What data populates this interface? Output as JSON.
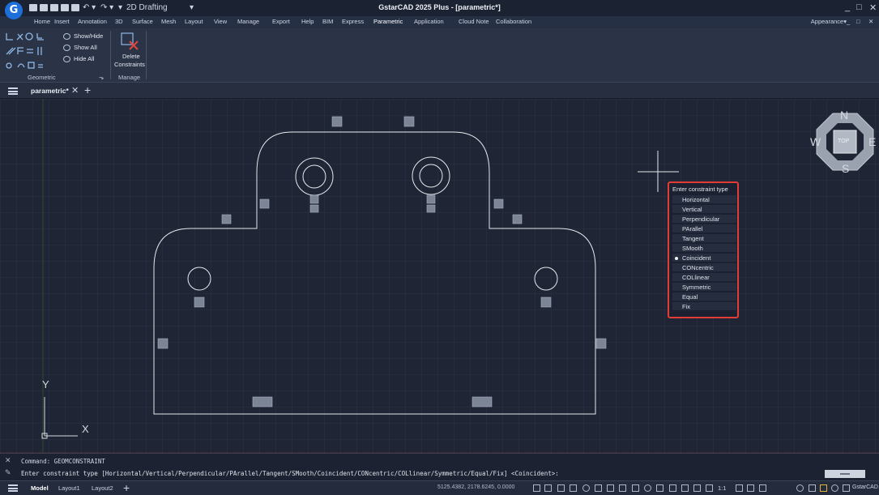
{
  "app": {
    "logo": "G",
    "title": "GstarCAD 2025 Plus - [parametric*]",
    "workspace": "2D Drafting",
    "window_controls": [
      "_",
      "□",
      "✕"
    ]
  },
  "menu": {
    "tabs": [
      "Home",
      "Insert",
      "Annotation",
      "3D",
      "Surface",
      "Mesh",
      "Layout",
      "View",
      "Manage",
      "Export",
      "Help",
      "BIM",
      "Express",
      "Parametric",
      "Application",
      "Cloud Note",
      "Collaboration"
    ],
    "active": "Parametric",
    "appearance": "Appearance"
  },
  "ribbon": {
    "show_hide": "Show/Hide",
    "show_all": "Show All",
    "hide_all": "Hide All",
    "delete_l1": "Delete",
    "delete_l2": "Constraints",
    "group_geometric": "Geometric",
    "group_manage": "Manage"
  },
  "document": {
    "tab": "parametric*"
  },
  "drawing": {
    "ucs_y": "Y",
    "ucs_x": "X",
    "viewcube": {
      "n": "N",
      "s": "S",
      "e": "E",
      "w": "W",
      "top": "TOP"
    }
  },
  "constraint_menu": {
    "title": "Enter constraint type",
    "items": [
      "Horizontal",
      "Vertical",
      "Perpendicular",
      "PArallel",
      "Tangent",
      "SMooth",
      "Coincident",
      "CONcentric",
      "COLlinear",
      "Symmetric",
      "Equal",
      "Fix"
    ],
    "selected": "Coincident"
  },
  "command": {
    "history": "Command: GEOMCONSTRAINT",
    "prompt": "Enter constraint type [Horizontal/Vertical/Perpendicular/PArallel/Tangent/SMooth/Coincident/CONcentric/COLlinear/Symmetric/Equal/Fix] <Coincident>:"
  },
  "status": {
    "tabs": [
      "Model",
      "Layout1",
      "Layout2"
    ],
    "coords": "5125.4382, 2178.6245, 0.0000",
    "scale": "1:1",
    "right_label": "GstarCAD"
  },
  "colors": {
    "background": "#1f2535",
    "ribbon": "#2b3346",
    "popup_border": "#e23d35",
    "geometry": "#e6e8ec",
    "constraint_icon": "#7c8596"
  }
}
